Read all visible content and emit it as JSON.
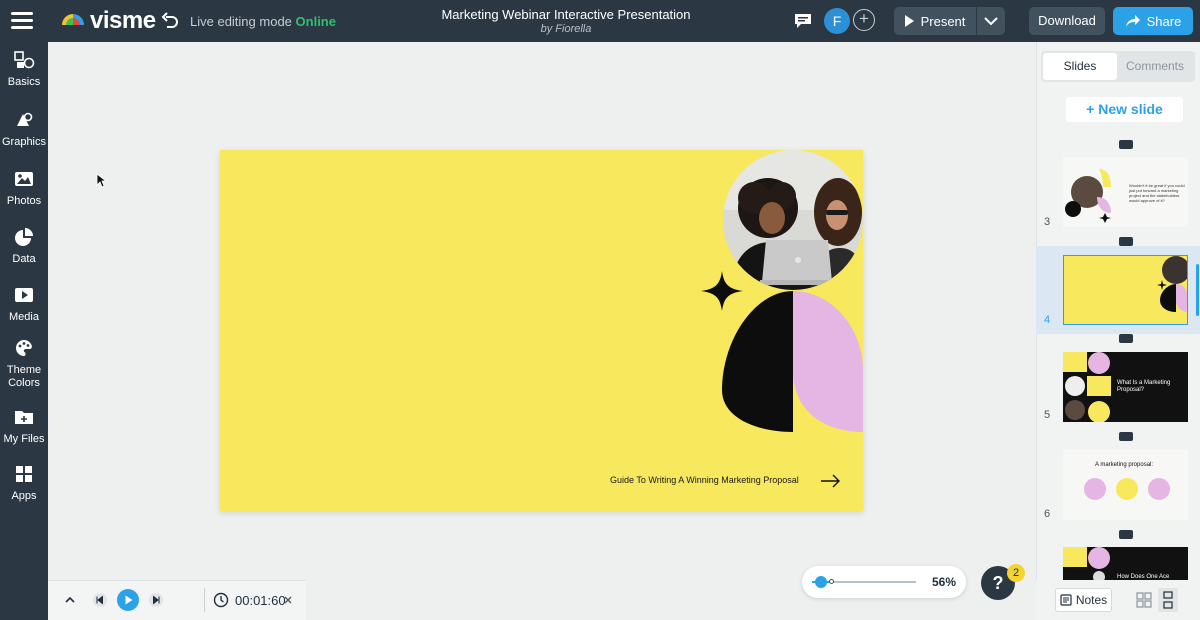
{
  "header": {
    "logo_text": "visme",
    "mode_label": "Live editing mode",
    "mode_status": "Online",
    "doc_title": "Marketing Webinar Interactive Presentation",
    "doc_author": "by Fiorella",
    "avatar_initial": "F",
    "present_label": "Present",
    "download_label": "Download",
    "share_label": "Share"
  },
  "sidebar": {
    "items": [
      {
        "label": "Basics",
        "icon": "shapes-icon"
      },
      {
        "label": "Graphics",
        "icon": "graphics-icon"
      },
      {
        "label": "Photos",
        "icon": "photo-icon"
      },
      {
        "label": "Data",
        "icon": "pie-chart-icon"
      },
      {
        "label": "Media",
        "icon": "media-icon"
      },
      {
        "label": "Theme Colors",
        "label_line1": "Theme",
        "label_line2": "Colors",
        "icon": "palette-icon"
      },
      {
        "label": "My Files",
        "label_line1": "My Files",
        "icon": "folder-icon"
      },
      {
        "label": "Apps",
        "icon": "apps-grid-icon"
      }
    ]
  },
  "slide": {
    "footer_text": "Guide To Writing A Winning Marketing Proposal",
    "colors": {
      "background": "#f7e85d",
      "black_shape": "#0d0d0d",
      "pink_shape": "#e5b5e3"
    }
  },
  "player": {
    "time": "00:01:60"
  },
  "zoom": {
    "percent": "56%",
    "level": 0.56
  },
  "help": {
    "label": "?",
    "badge_count": "2"
  },
  "right_panel": {
    "tabs": [
      {
        "label": "Slides",
        "active": true
      },
      {
        "label": "Comments",
        "active": false
      }
    ],
    "new_slide_label": "+ New slide",
    "thumbnails": [
      {
        "number": "3",
        "text": "Wouldn't it be great if you could just put forward a marketing project and the stakeholders would approve of it?"
      },
      {
        "number": "4",
        "selected": true
      },
      {
        "number": "5",
        "text": "What Is a Marketing Proposal?"
      },
      {
        "number": "6",
        "text": "A marketing proposal:"
      },
      {
        "number": "",
        "text": "How Does One Ace"
      }
    ],
    "notes_label": "Notes"
  },
  "colors": {
    "topbar": "#2b3843",
    "accent_blue": "#2ba2e7",
    "online_green": "#2fbf71",
    "badge_yellow": "#f5d330"
  }
}
